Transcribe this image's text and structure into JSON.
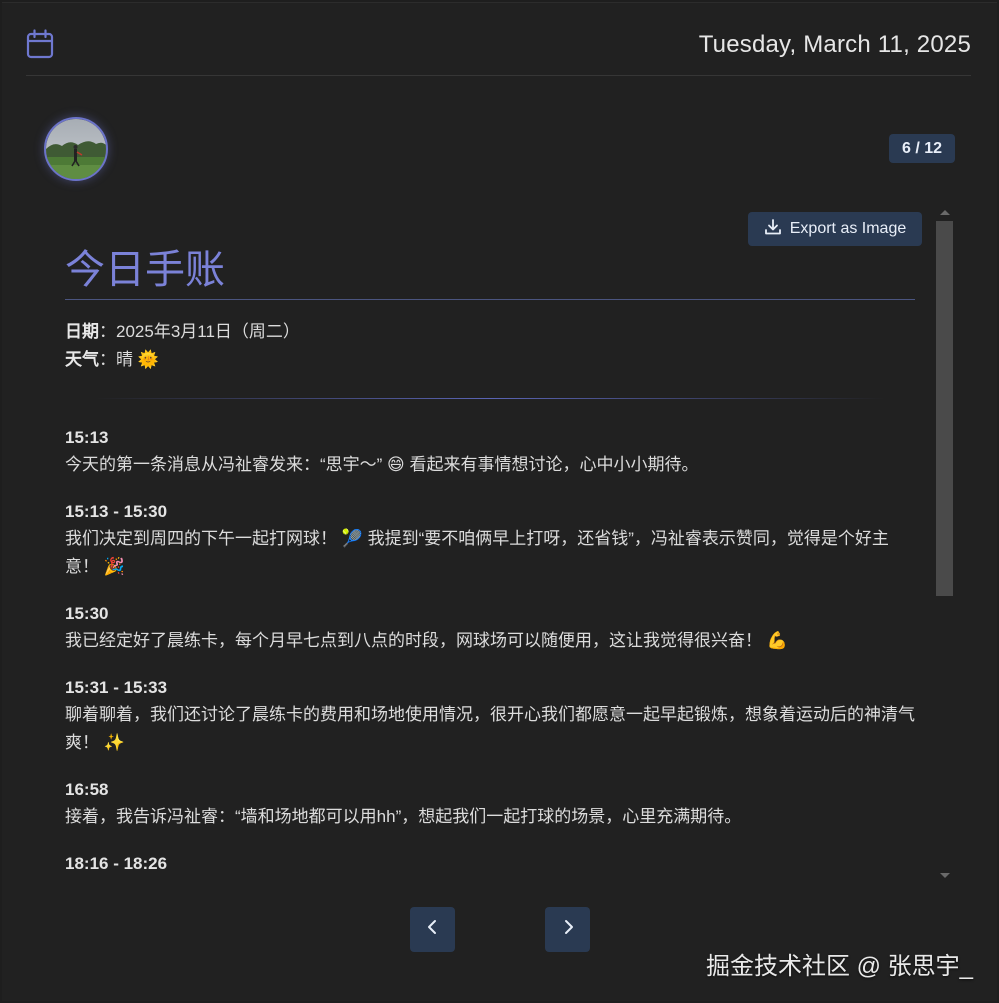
{
  "header": {
    "date": "Tuesday, March 11, 2025"
  },
  "pager": {
    "counter": "6 / 12"
  },
  "toolbar": {
    "export_label": "Export as Image"
  },
  "journal": {
    "title": "今日手账",
    "date_label": "日期",
    "date_value": "：2025年3月11日（周二）",
    "weather_label": "天气",
    "weather_value": "：晴 🌞",
    "entries": [
      {
        "time": "15:13",
        "text": "今天的第一条消息从冯祉睿发来：“思宇～” 😄 看起来有事情想讨论，心中小小期待。"
      },
      {
        "time": "15:13 - 15:30",
        "text": "我们决定到周四的下午一起打网球！ 🎾 我提到“要不咱俩早上打呀，还省钱”，冯祉睿表示赞同，觉得是个好主意！ 🎉"
      },
      {
        "time": "15:30",
        "text": "我已经定好了晨练卡，每个月早七点到八点的时段，网球场可以随便用，这让我觉得很兴奋！ 💪"
      },
      {
        "time": "15:31 - 15:33",
        "text": "聊着聊着，我们还讨论了晨练卡的费用和场地使用情况，很开心我们都愿意一起早起锻炼，想象着运动后的神清气爽！ ✨"
      },
      {
        "time": "16:58",
        "text": "接着，我告诉冯祉睿：“墙和场地都可以用hh”，想起我们一起打球的场景，心里充满期待。"
      },
      {
        "time": "18:16 - 18:26",
        "text": ""
      }
    ]
  },
  "watermark": "掘金技术社区 @ 张思宇_",
  "icons": {
    "calendar": "calendar-icon",
    "download": "download-icon",
    "prev": "chevron-left-icon",
    "next": "chevron-right-icon"
  },
  "colors": {
    "accent": "#7b82d8",
    "button_bg": "#2a3a52",
    "background": "#212121"
  }
}
